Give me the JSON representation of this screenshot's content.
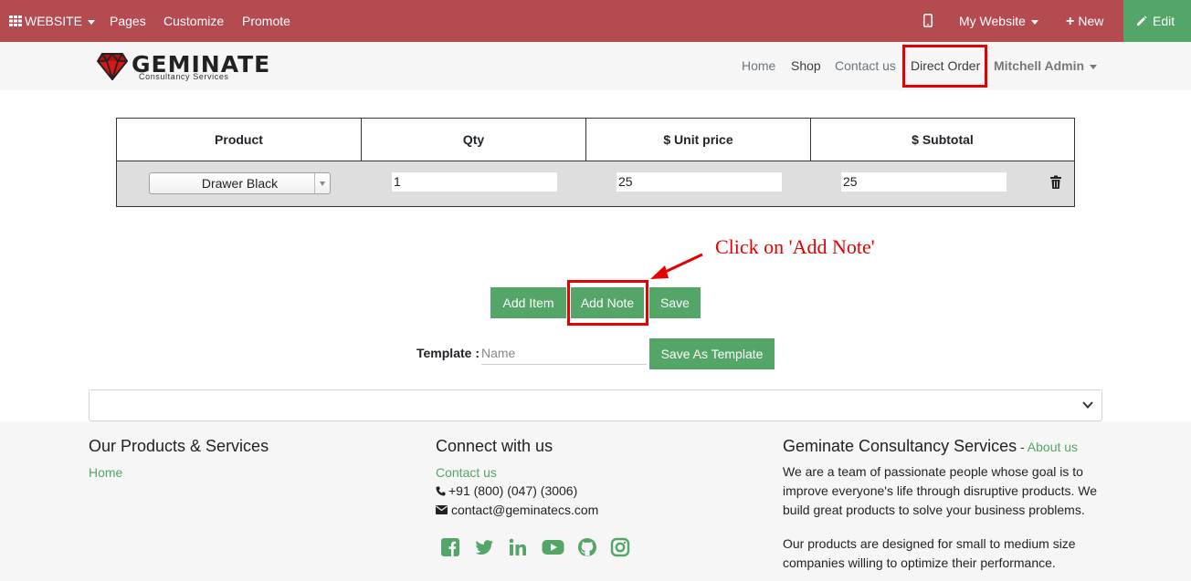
{
  "topbar": {
    "website_label": "WEBSITE",
    "pages_label": "Pages",
    "customize_label": "Customize",
    "promote_label": "Promote",
    "my_website_label": "My Website",
    "new_label": "New",
    "edit_label": "Edit",
    "bar_color": "#b34b50",
    "edit_color": "#54a568"
  },
  "navbar": {
    "logo_text": "GEMINATE",
    "logo_sub": "Consultancy Services",
    "links": {
      "home": "Home",
      "shop": "Shop",
      "contact": "Contact us",
      "direct_order": "Direct Order",
      "user": "Mitchell Admin"
    }
  },
  "table": {
    "headers": [
      "Product",
      "Qty",
      "$ Unit price",
      "$ Subtotal"
    ],
    "row": {
      "product": "Drawer Black",
      "qty": "1",
      "unit_price": "25",
      "subtotal": "25"
    }
  },
  "annotation": "Click on 'Add Note'",
  "buttons": {
    "add_item": "Add Item",
    "add_note": "Add Note",
    "save": "Save",
    "save_template": "Save As Template"
  },
  "template": {
    "label": "Template :",
    "placeholder": "Name"
  },
  "footer": {
    "col1": {
      "heading": "Our Products & Services",
      "link": "Home"
    },
    "col2": {
      "heading": "Connect with us",
      "link": "Contact us",
      "phone": "+91 (800) (047) (3006)",
      "email": "contact@geminatecs.com",
      "social_icons": [
        "facebook-icon",
        "twitter-icon",
        "linkedin-icon",
        "youtube-icon",
        "github-icon",
        "instagram-icon"
      ]
    },
    "col3": {
      "heading": "Geminate Consultancy Services",
      "heading_sep": " - ",
      "about_link": "About us",
      "para1": "We are a team of passionate people whose goal is to improve everyone's life through disruptive products. We build great products to solve your business problems.",
      "para2": "Our products are designed for small to medium size companies willing to optimize their performance."
    }
  },
  "colors": {
    "accent_green": "#54a568",
    "highlight_red": "#e60000"
  }
}
